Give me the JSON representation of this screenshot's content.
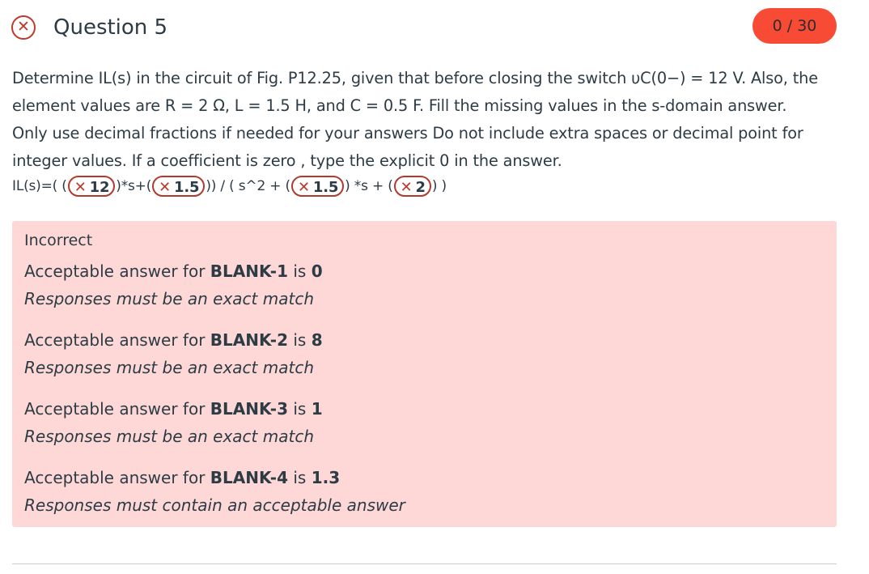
{
  "question": {
    "title": "Question 5",
    "score": "0 / 30",
    "status_icon": "x-circle-icon",
    "body": [
      "Determine IL(s) in the circuit of Fig. P12.25, given that before closing the switch υC(0−) = 12 V. Also, the",
      "element values are R = 2 Ω, L = 1.5 H, and C = 0.5 F. Fill the missing values in the s-domain answer.",
      "Only use decimal fractions if needed for your answers Do not include extra spaces or decimal point for",
      "integer values. If a coefficient is zero , type the explicit 0 in the answer."
    ],
    "formula": {
      "p1": "IL(s)=( (",
      "p2": ")*s+(",
      "p3": ")) / ( s^2 + (",
      "p4": ") *s + (",
      "p5": ") )",
      "blank1": "12",
      "blank2": "1.5",
      "blank3": "1.5",
      "blank4": "2"
    }
  },
  "feedback": {
    "title": "Incorrect",
    "prefix": "Acceptable answer for",
    "is_word": "is",
    "items": [
      {
        "blank": "BLANK-1",
        "answer": "0",
        "note": "Responses must be an exact match"
      },
      {
        "blank": "BLANK-2",
        "answer": "8",
        "note": "Responses must be an exact match"
      },
      {
        "blank": "BLANK-3",
        "answer": "1",
        "note": "Responses must be an exact match"
      },
      {
        "blank": "BLANK-4",
        "answer": "1.3",
        "note": "Responses must contain an acceptable answer"
      }
    ]
  },
  "colors": {
    "incorrect_red": "#c0392b",
    "score_pill": "#f74b35",
    "feedback_bg": "#fdd8d6"
  }
}
